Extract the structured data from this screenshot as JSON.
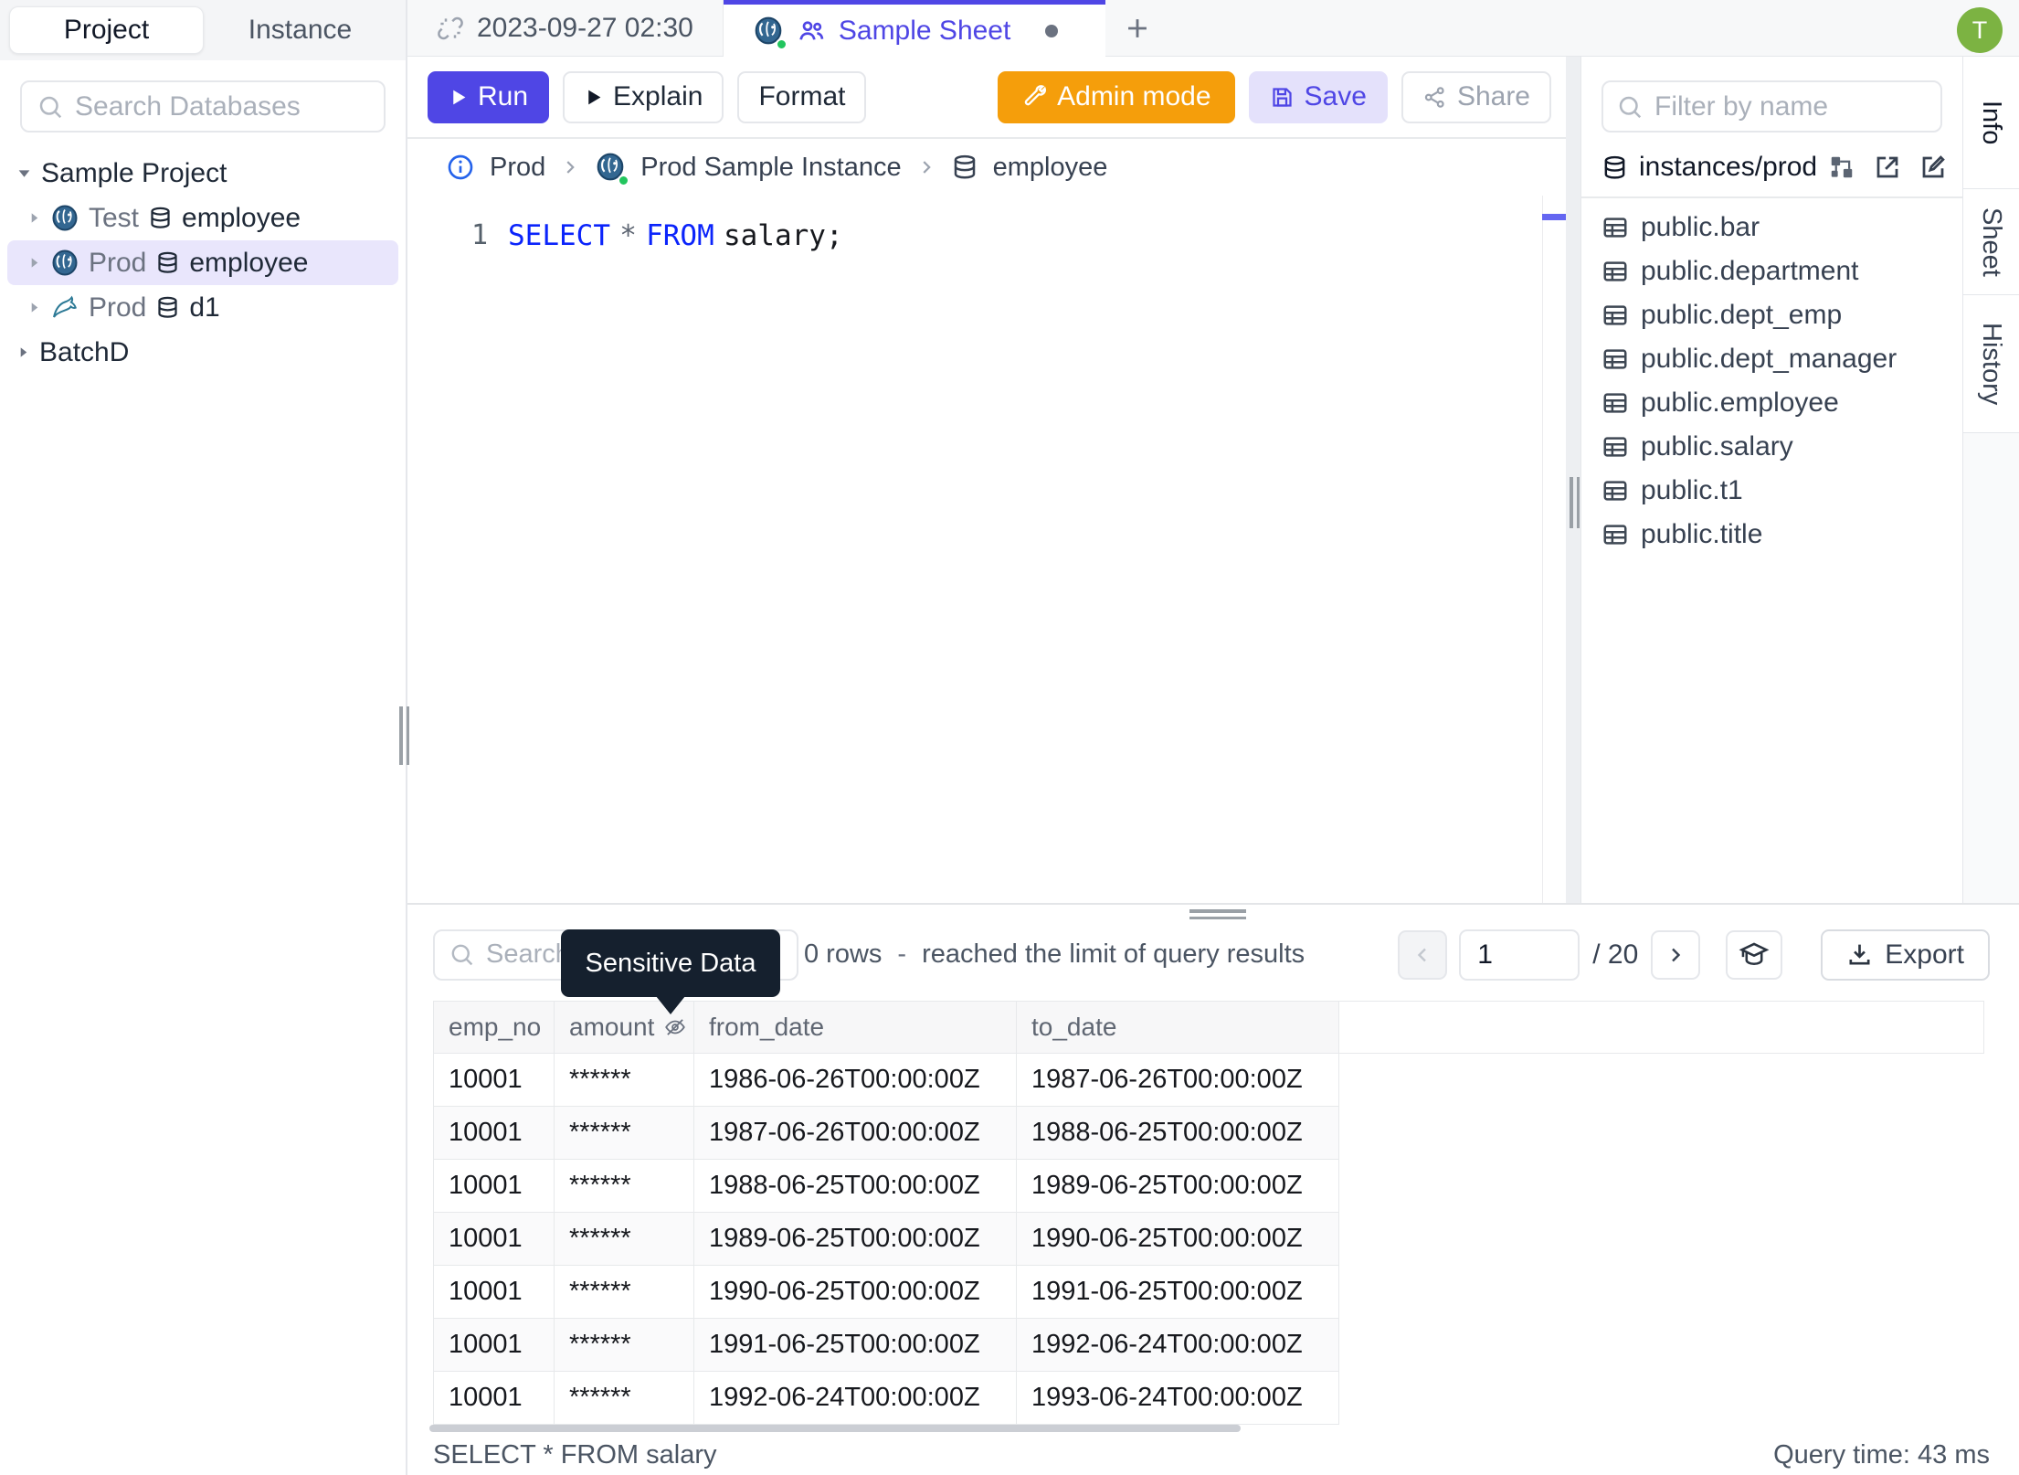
{
  "sidebar": {
    "tabs": {
      "project": "Project",
      "instance": "Instance"
    },
    "search_placeholder": "Search Databases",
    "tree": {
      "project_label": "Sample Project",
      "databases": [
        {
          "engine": "postgres",
          "env": "Test",
          "name": "employee"
        },
        {
          "engine": "postgres",
          "env": "Prod",
          "name": "employee"
        },
        {
          "engine": "mysql",
          "env": "Prod",
          "name": "d1"
        }
      ],
      "batch_label": "BatchD"
    }
  },
  "header": {
    "tab_recent": "2023-09-27 02:30",
    "tab_sheet": "Sample Sheet",
    "avatar": "T"
  },
  "toolbar": {
    "run": "Run",
    "explain": "Explain",
    "format": "Format",
    "admin_mode": "Admin mode",
    "save": "Save",
    "share": "Share"
  },
  "breadcrumb": {
    "environment": "Prod",
    "instance": "Prod Sample Instance",
    "database": "employee"
  },
  "editor": {
    "line_number": "1",
    "sql": {
      "kw_select": "SELECT",
      "star": "*",
      "kw_from": "FROM",
      "rest": "salary;"
    }
  },
  "schema_panel": {
    "filter_placeholder": "Filter by name",
    "source": "instances/prod",
    "tables": [
      "public.bar",
      "public.department",
      "public.dept_emp",
      "public.dept_manager",
      "public.employee",
      "public.salary",
      "public.t1",
      "public.title"
    ]
  },
  "side_tabs": [
    "Info",
    "Sheet",
    "History"
  ],
  "results": {
    "search_placeholder": "Search",
    "tooltip": "Sensitive Data",
    "rows_count_text": "0 rows",
    "separator": "-",
    "limit_text": "reached the limit of query results",
    "pagination": {
      "page": "1",
      "total": "/ 20"
    },
    "export_label": "Export",
    "columns": [
      "emp_no",
      "amount",
      "from_date",
      "to_date"
    ],
    "rows": [
      [
        "10001",
        "******",
        "1986-06-26T00:00:00Z",
        "1987-06-26T00:00:00Z"
      ],
      [
        "10001",
        "******",
        "1987-06-26T00:00:00Z",
        "1988-06-25T00:00:00Z"
      ],
      [
        "10001",
        "******",
        "1988-06-25T00:00:00Z",
        "1989-06-25T00:00:00Z"
      ],
      [
        "10001",
        "******",
        "1989-06-25T00:00:00Z",
        "1990-06-25T00:00:00Z"
      ],
      [
        "10001",
        "******",
        "1990-06-25T00:00:00Z",
        "1991-06-25T00:00:00Z"
      ],
      [
        "10001",
        "******",
        "1991-06-25T00:00:00Z",
        "1992-06-24T00:00:00Z"
      ],
      [
        "10001",
        "******",
        "1992-06-24T00:00:00Z",
        "1993-06-24T00:00:00Z"
      ]
    ],
    "status_sql": "SELECT * FROM salary",
    "status_time": "Query time: 43 ms"
  },
  "colors": {
    "accent": "#4f46e5",
    "admin_mode": "#f59e0b",
    "avatar": "#7cb342",
    "tooltip_bg": "#15202e",
    "selected_tree_row": "#e9e6fc",
    "sql_keyword": "#0b24fb",
    "status_online": "#22c55e"
  }
}
